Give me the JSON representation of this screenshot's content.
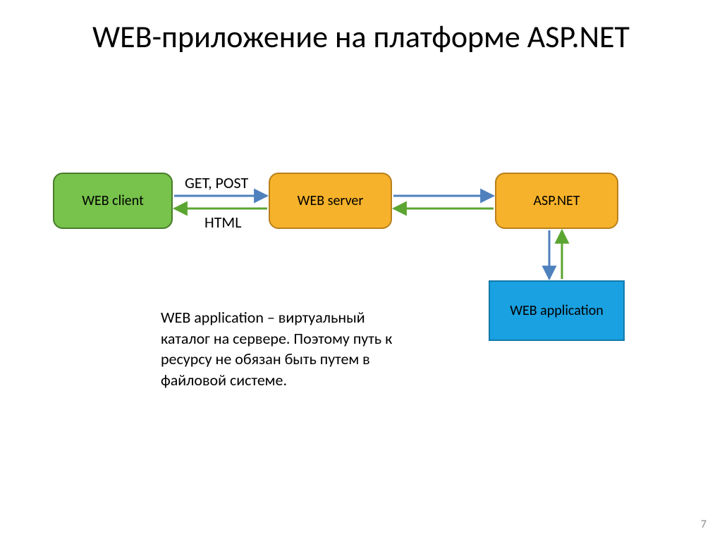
{
  "title": "WEB-приложение на платформе ASP.NET",
  "nodes": {
    "web_client": {
      "label": "WEB client"
    },
    "web_server": {
      "label": "WEB server"
    },
    "aspnet": {
      "label": "ASP.NET"
    },
    "web_application": {
      "label": "WEB application"
    }
  },
  "arrow_labels": {
    "top": "GET, POST",
    "bottom": "HTML"
  },
  "body_text": "WEB application – виртуальный каталог на сервере. Поэтому путь к ресурсу не обязан быть путем в файловой системе.",
  "page_number": "7",
  "colors": {
    "green": "#77C34B",
    "orange": "#F6B22A",
    "blue": "#1AA1E1",
    "arrow_blue": "#4F81BD",
    "arrow_green": "#5BA532"
  }
}
